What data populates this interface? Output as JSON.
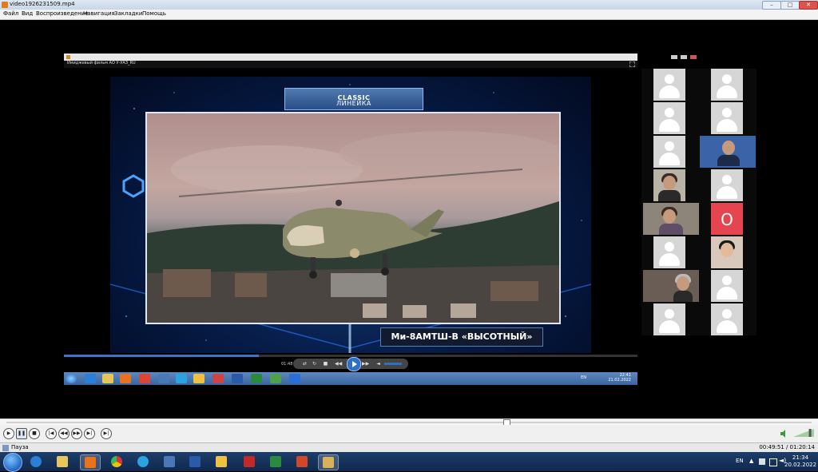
{
  "window": {
    "title": "video1926231509.mp4",
    "controls": {
      "minimize": "–",
      "maximize": "□",
      "close": "✕"
    }
  },
  "menu": {
    "items": [
      "Файл",
      "Вид",
      "Воспроизведение",
      "Навигация",
      "Закладки",
      "Помощь"
    ]
  },
  "shared_screen": {
    "window_title": "Имиджевый фильм АО У-УАЗ_RU",
    "banner": {
      "prefix": "ЛИНЕЙКА ",
      "bold": "CLASSIC"
    },
    "caption": "Ми-8АМТШ-В «ВЫСОТНЫЙ»",
    "progress": 0.34,
    "elapsed_time": "01:48",
    "taskbar": {
      "lang": "EN",
      "clock_time": "22:41",
      "clock_date": "21.02.2022"
    }
  },
  "participants": {
    "tiles": [
      {
        "type": "placeholder"
      },
      {
        "type": "placeholder"
      },
      {
        "type": "placeholder"
      },
      {
        "type": "placeholder"
      },
      {
        "type": "placeholder"
      },
      {
        "type": "photo"
      },
      {
        "type": "photo"
      },
      {
        "type": "placeholder"
      },
      {
        "type": "photo"
      },
      {
        "type": "initial",
        "text": "О"
      },
      {
        "type": "placeholder"
      },
      {
        "type": "photo"
      },
      {
        "type": "photo"
      },
      {
        "type": "placeholder"
      },
      {
        "type": "placeholder"
      },
      {
        "type": "placeholder"
      }
    ]
  },
  "player": {
    "seek_position": 0.62,
    "volume": 0.85,
    "status": "Пауза",
    "time": "00:49:51 / 01:20:14"
  },
  "taskbar": {
    "lang": "EN",
    "tray_arrow": "▲",
    "clock_time": "21:34",
    "clock_date": "20.02.2022"
  },
  "colors": {
    "accent": "#2f6fc6",
    "zero_tile": "#e4454f",
    "taskbar": "#10284d"
  },
  "icons": {
    "player_controls": [
      "play-icon",
      "pause-icon",
      "stop-icon",
      "previous-icon",
      "rewind-icon",
      "forward-icon",
      "next-icon",
      "frame-step-icon"
    ],
    "taskbar_apps": [
      "ie-icon",
      "folder-icon",
      "media-player-icon",
      "chrome-icon",
      "telegram-icon",
      "printer-icon",
      "word-icon",
      "paint-icon",
      "acrobat-icon",
      "excel-icon",
      "powerpoint-icon",
      "video-player-icon"
    ]
  }
}
